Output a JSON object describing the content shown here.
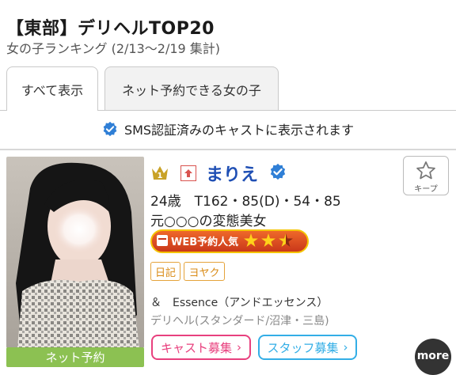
{
  "header": {
    "title": "【東部】デリヘルTOP20",
    "subtitle": "女の子ランキング (2/13〜2/19 集計)"
  },
  "tabs": [
    {
      "label": "すべて表示",
      "active": true
    },
    {
      "label": "ネット予約できる女の子",
      "active": false
    }
  ],
  "notice": {
    "text": "SMS認証済みのキャストに表示されます"
  },
  "cast": {
    "rank": "1",
    "name": "まりえ",
    "stats": "24歳　T162・85(D)・54・85",
    "catchphrase": "元○○○の変態美女",
    "web_popularity": {
      "label": "WEB予約人気",
      "stars": 2.5
    },
    "tags": [
      "日記",
      "ヨヤク"
    ],
    "shop_name": "＆　Essence（アンドエッセンス）",
    "shop_info": "デリヘル(スタンダード/沼津・三島)",
    "net_reserve_label": "ネット予約",
    "keep_label": "キープ"
  },
  "actions": {
    "cast_recruit": "キャスト募集",
    "staff_recruit": "スタッフ募集",
    "more": "more"
  },
  "colors": {
    "name": "#1f4fb4",
    "verified": "#2f7fd6",
    "net_reserve": "#8cc152",
    "tag": "#e5a33b",
    "cast_recruit": "#e8407e",
    "staff_recruit": "#33aee6"
  }
}
